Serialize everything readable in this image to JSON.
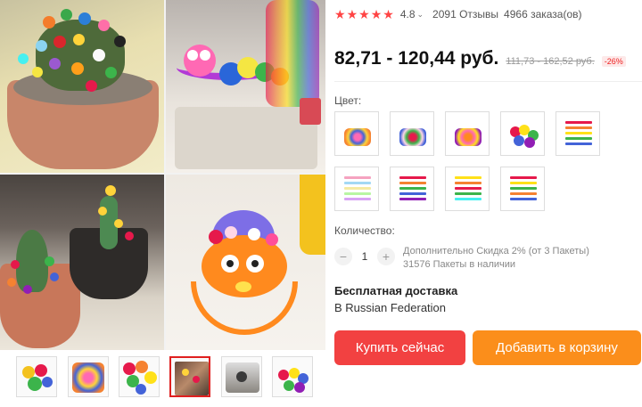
{
  "rating": {
    "stars": [
      "★",
      "★",
      "★",
      "★",
      "★"
    ],
    "value": "4.8",
    "chevron": "⌄",
    "reviews": "2091 Отзывы",
    "orders": "4966 заказа(ов)"
  },
  "price": {
    "current": "82,71 - 120,44 руб.",
    "old": "111,73 - 162,52 руб.",
    "discount": "-26%"
  },
  "color": {
    "label": "Цвет:"
  },
  "quantity": {
    "label": "Количество:",
    "minus": "−",
    "value": "1",
    "plus": "+",
    "discount_text": "Дополнительно Скидка 2% (от 3 Пакеты)",
    "stock_text": "31576 Пакеты в наличии"
  },
  "shipping": {
    "title": "Бесплатная доставка",
    "destination": "В Russian Federation"
  },
  "buttons": {
    "buy": "Купить сейчас",
    "cart": "Добавить в корзину"
  },
  "colors": {
    "star": "#ff4747",
    "buy_button": "#f24141",
    "cart_button": "#fb8e1b",
    "discount": "#ee2222"
  }
}
